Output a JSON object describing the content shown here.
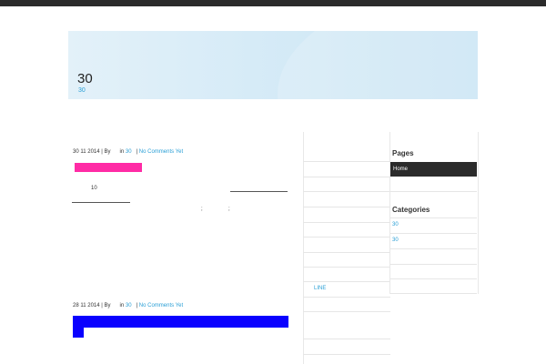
{
  "site": {
    "title": "30",
    "description": "30"
  },
  "posts": [
    {
      "date": "30 11  2014",
      "by_label": "| By",
      "in_label": "in",
      "category": "30",
      "comments": "No Comments Yet",
      "highlight_color": "#ff2ba5",
      "body_number": "10",
      "body_punct": [
        ";",
        ";"
      ]
    },
    {
      "date": "28 11  2014",
      "by_label": "| By",
      "in_label": "in",
      "category": "30",
      "comments": "No Comments Yet",
      "highlight_color": "#0a00ff"
    }
  ],
  "middle_sidebar": {
    "link": "LINE"
  },
  "right_sidebar": {
    "pages_title": "Pages",
    "pages": [
      "Home"
    ],
    "categories_title": "Categories",
    "categories": [
      "30",
      "30"
    ]
  },
  "colors": {
    "link": "#2a9fd6",
    "topbar": "#2b2b2b",
    "header_bg": "#d6ebf7"
  }
}
